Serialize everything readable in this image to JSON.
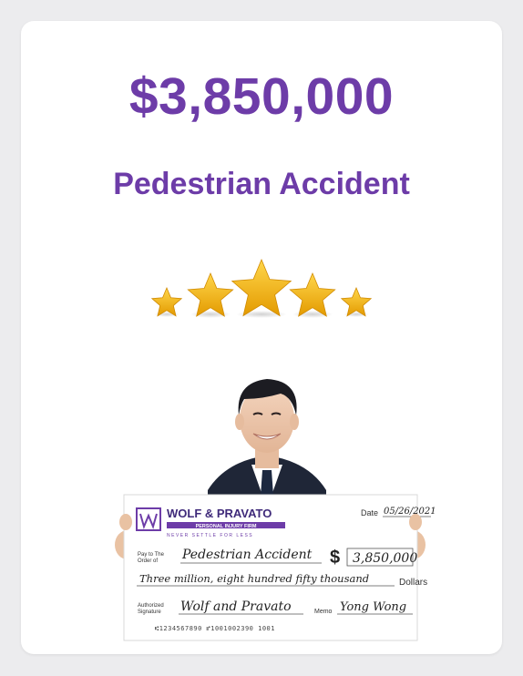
{
  "result": {
    "amount": "$3,850,000",
    "case_type": "Pedestrian Accident",
    "rating": 5,
    "rating_max": 5
  },
  "check": {
    "firm_name": "WOLF & PRAVATO",
    "firm_subtitle": "PERSONAL INJURY FIRM",
    "tagline": "NEVER SETTLE FOR LESS",
    "date_label": "Date",
    "date_value": "05/26/2021",
    "pay_to_label_1": "Pay to The",
    "pay_to_label_2": "Order of",
    "payee": "Pedestrian Accident",
    "dollar_sign": "$",
    "numeric_amount": "3,850,000",
    "written_amount": "Three million, eight hundred fifty thousand",
    "dollars_label": "Dollars",
    "auth_label_1": "Authorized",
    "auth_label_2": "Signature",
    "signature": "Wolf and Pravato",
    "memo_label": "Memo",
    "memo_value": "Yong Wong",
    "micr": "⑆1234567890  ⑈1001002390  1001"
  },
  "colors": {
    "accent": "#6d3ca8",
    "star_gold": "#f5b50a",
    "suit": "#1f2637",
    "background": "#ececee"
  }
}
